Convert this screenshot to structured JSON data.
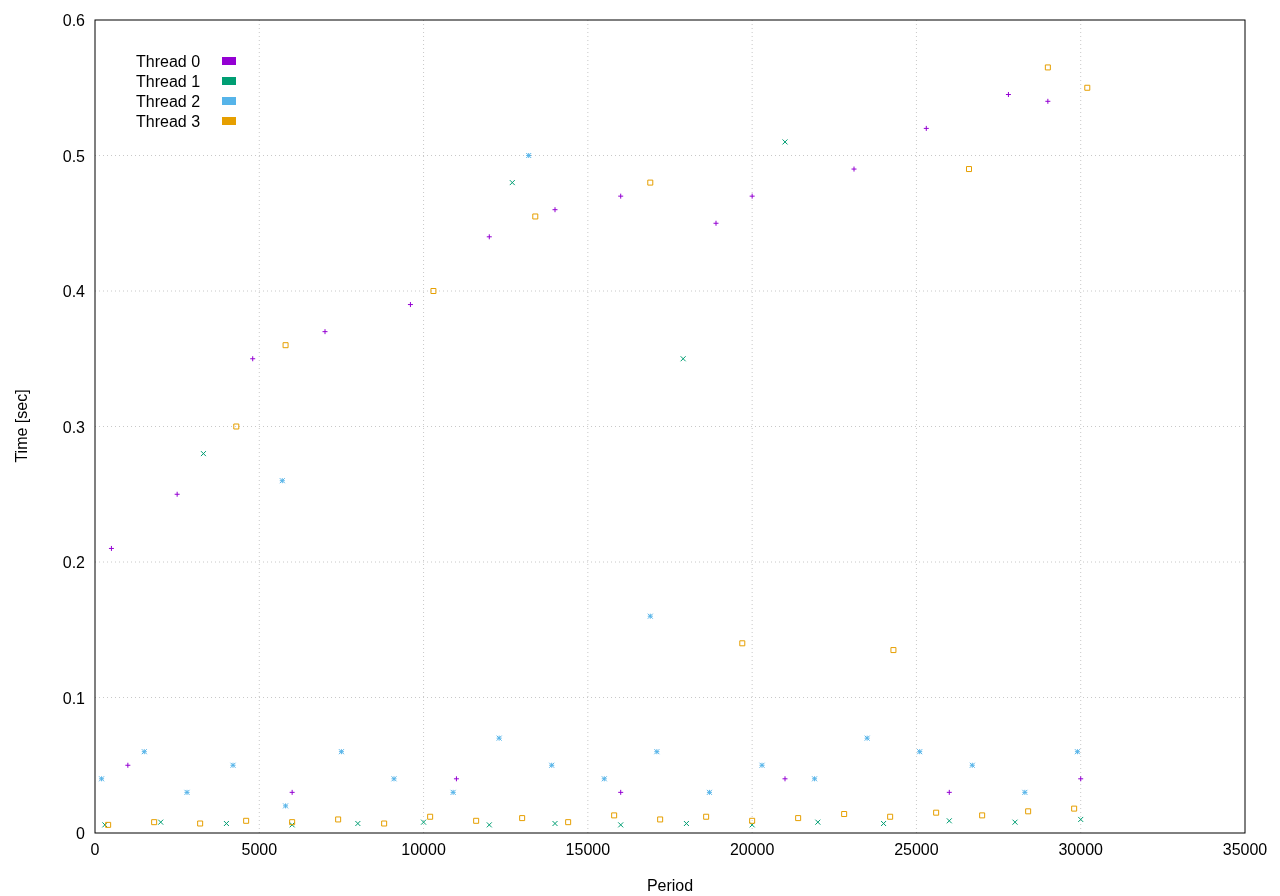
{
  "chart_data": {
    "type": "scatter",
    "grid": true,
    "legend": "upper left",
    "xlabel": "Period",
    "ylabel": "Time [sec]",
    "xlim": [
      0,
      35000
    ],
    "ylim": [
      0,
      0.6
    ],
    "xticks": [
      0,
      5000,
      10000,
      15000,
      20000,
      25000,
      30000,
      35000
    ],
    "yticks": [
      0,
      0.1,
      0.2,
      0.3,
      0.4,
      0.5,
      0.6
    ],
    "series": [
      {
        "name": "Thread 0",
        "color": "#9400d3",
        "x": [
          500,
          2500,
          4800,
          7000,
          9600,
          12000,
          14000,
          16000,
          18900,
          20000,
          23100,
          25300,
          27800,
          29000,
          1000,
          6000,
          11000,
          16000,
          21000,
          26000,
          30000
        ],
        "values": [
          0.21,
          0.25,
          0.35,
          0.37,
          0.39,
          0.44,
          0.46,
          0.47,
          0.45,
          0.47,
          0.49,
          0.52,
          0.545,
          0.54,
          0.05,
          0.03,
          0.04,
          0.03,
          0.04,
          0.03,
          0.04
        ]
      },
      {
        "name": "Thread 1",
        "color": "#009e73",
        "x": [
          300,
          2000,
          4000,
          6000,
          8000,
          10000,
          12000,
          14000,
          16000,
          18000,
          20000,
          22000,
          24000,
          26000,
          28000,
          30000,
          3300,
          12700,
          17900,
          21000
        ],
        "values": [
          0.006,
          0.008,
          0.007,
          0.006,
          0.007,
          0.008,
          0.006,
          0.007,
          0.006,
          0.007,
          0.006,
          0.008,
          0.007,
          0.009,
          0.008,
          0.01,
          0.28,
          0.48,
          0.35,
          0.51
        ]
      },
      {
        "name": "Thread 2",
        "color": "#56b4e9",
        "x": [
          200,
          1500,
          2800,
          4200,
          5800,
          7500,
          9100,
          10900,
          12300,
          13900,
          15500,
          17100,
          18700,
          20300,
          21900,
          23500,
          25100,
          26700,
          28300,
          29900,
          5700,
          13200,
          16900
        ],
        "values": [
          0.04,
          0.06,
          0.03,
          0.05,
          0.02,
          0.06,
          0.04,
          0.03,
          0.07,
          0.05,
          0.04,
          0.06,
          0.03,
          0.05,
          0.04,
          0.07,
          0.06,
          0.05,
          0.03,
          0.06,
          0.26,
          0.5,
          0.16
        ]
      },
      {
        "name": "Thread 3",
        "color": "#e69f00",
        "x": [
          400,
          1800,
          3200,
          4600,
          6000,
          7400,
          8800,
          10200,
          11600,
          13000,
          14400,
          15800,
          17200,
          18600,
          20000,
          21400,
          22800,
          24200,
          25600,
          27000,
          28400,
          29800,
          4300,
          5800,
          10300,
          13400,
          16900,
          19700,
          24300,
          26600,
          29000,
          30200
        ],
        "values": [
          0.006,
          0.008,
          0.007,
          0.009,
          0.008,
          0.01,
          0.007,
          0.012,
          0.009,
          0.011,
          0.008,
          0.013,
          0.01,
          0.012,
          0.009,
          0.011,
          0.014,
          0.012,
          0.015,
          0.013,
          0.016,
          0.018,
          0.3,
          0.36,
          0.4,
          0.455,
          0.48,
          0.14,
          0.135,
          0.49,
          0.565,
          0.55
        ]
      }
    ]
  }
}
